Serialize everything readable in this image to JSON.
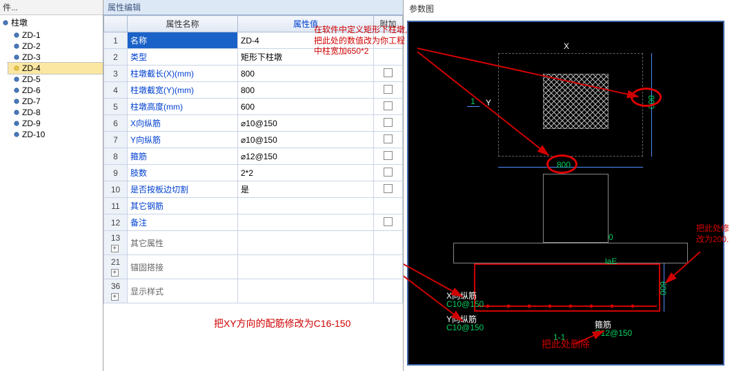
{
  "tree": {
    "header": "件...",
    "root": "柱墩",
    "items": [
      "ZD-1",
      "ZD-2",
      "ZD-3",
      "ZD-4",
      "ZD-5",
      "ZD-6",
      "ZD-7",
      "ZD-8",
      "ZD-9",
      "ZD-10"
    ],
    "selected_index": 3
  },
  "prop_tab": "属性编辑",
  "prop_headers": {
    "name": "属性名称",
    "value": "属性值",
    "extra": "附加"
  },
  "rows": [
    {
      "n": "1",
      "name": "名称",
      "val": "ZD-4",
      "extra": "",
      "sel": true
    },
    {
      "n": "2",
      "name": "类型",
      "val": "矩形下柱墩",
      "extra": ""
    },
    {
      "n": "3",
      "name": "柱墩截长(X)(mm)",
      "val": "800",
      "extra": "chk"
    },
    {
      "n": "4",
      "name": "柱墩截宽(Y)(mm)",
      "val": "800",
      "extra": "chk"
    },
    {
      "n": "5",
      "name": "柱墩高度(mm)",
      "val": "600",
      "extra": "chk"
    },
    {
      "n": "6",
      "name": "X向纵筋",
      "val": "⌀10@150",
      "extra": "chk"
    },
    {
      "n": "7",
      "name": "Y向纵筋",
      "val": "⌀10@150",
      "extra": "chk"
    },
    {
      "n": "8",
      "name": "箍筋",
      "val": "⌀12@150",
      "extra": "chk"
    },
    {
      "n": "9",
      "name": "肢数",
      "val": "2*2",
      "extra": "chk"
    },
    {
      "n": "10",
      "name": "是否按板边切割",
      "val": "是",
      "extra": "chk"
    },
    {
      "n": "11",
      "name": "其它钢筋",
      "val": "",
      "extra": ""
    },
    {
      "n": "12",
      "name": "备注",
      "val": "",
      "extra": "chk"
    },
    {
      "n": "13",
      "name": "其它属性",
      "val": "",
      "extra": "",
      "exp": true
    },
    {
      "n": "21",
      "name": "锚固搭接",
      "val": "",
      "extra": "",
      "exp": true
    },
    {
      "n": "36",
      "name": "显示样式",
      "val": "",
      "extra": "",
      "exp": true
    }
  ],
  "right_title": "参数图",
  "diagram": {
    "top": {
      "x_label": "X",
      "y_label": "Y",
      "dim_x": "800",
      "dim_y": "800",
      "tick": "1"
    },
    "bottom": {
      "zero": "0",
      "lae": "laE",
      "height": "600",
      "x_label": "X向纵筋",
      "x_val": "C10@150",
      "y_label": "Y向纵筋",
      "y_val": "C10@150",
      "g_label": "箍筋",
      "g_val": "C12@150",
      "sec": "1-1"
    }
  },
  "annotations": {
    "a1_l1": "在软件中定义矩形下柱墩,",
    "a1_l2": "把此处的数值改为你工程",
    "a1_l3": "中柱宽加650*2",
    "a2": "把XY方向的配筋修改为C16-150",
    "a3_l1": "把此处修",
    "a3_l2": "改为200.",
    "a4": "把此处删除"
  }
}
